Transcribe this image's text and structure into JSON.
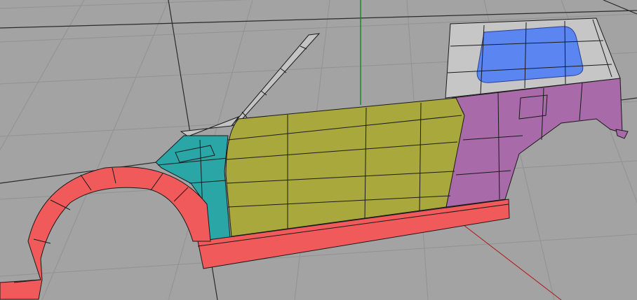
{
  "viewport": {
    "type": "3d-modeling-viewport",
    "content": "car-body-wireframe-side-view",
    "colors": {
      "background": "#a3a3a3",
      "grid_line": "#929292",
      "grid_dark": "#2a2a2a",
      "axis_y": "#0b8a1b",
      "axis_x": "#b01515",
      "mesh_edge": "#1a1a1a",
      "rear_window_frame": "#c6c6c6",
      "rear_window_glass": "#5b86f2",
      "quarter_panel": "#a86aa9",
      "door": "#a9a83d",
      "fender": "#2aa6a6",
      "sill_and_arch": "#f05a5a",
      "windshield_pillar": "#c3c3c3"
    }
  },
  "parts": [
    {
      "id": "rear-window",
      "icon": "glass-panel"
    },
    {
      "id": "rear-quarter-panel",
      "icon": "body-panel"
    },
    {
      "id": "door-panel",
      "icon": "body-panel"
    },
    {
      "id": "front-fender",
      "icon": "body-panel"
    },
    {
      "id": "rocker-sill",
      "icon": "body-panel"
    },
    {
      "id": "wheel-arch",
      "icon": "body-panel"
    },
    {
      "id": "windshield-pillar",
      "icon": "frame"
    }
  ]
}
